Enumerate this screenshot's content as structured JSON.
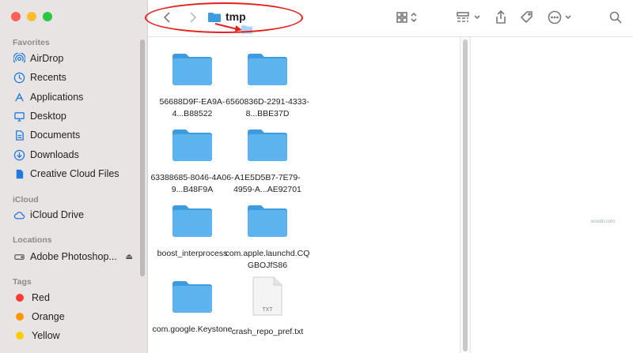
{
  "sidebar": {
    "favorites_header": "Favorites",
    "favorites": [
      {
        "label": "AirDrop",
        "icon": "airdrop-icon"
      },
      {
        "label": "Recents",
        "icon": "clock-icon"
      },
      {
        "label": "Applications",
        "icon": "applications-icon"
      },
      {
        "label": "Desktop",
        "icon": "desktop-icon"
      },
      {
        "label": "Documents",
        "icon": "document-icon"
      },
      {
        "label": "Downloads",
        "icon": "download-icon"
      },
      {
        "label": "Creative Cloud Files",
        "icon": "file-icon"
      }
    ],
    "icloud_header": "iCloud",
    "icloud": [
      {
        "label": "iCloud Drive",
        "icon": "cloud-icon"
      }
    ],
    "locations_header": "Locations",
    "locations": [
      {
        "label": "Adobe Photoshop...",
        "icon": "drive-icon",
        "eject": "⏏"
      }
    ],
    "tags_header": "Tags",
    "tags": [
      {
        "label": "Red",
        "color": "#fe3b30"
      },
      {
        "label": "Orange",
        "color": "#ff9500"
      },
      {
        "label": "Yellow",
        "color": "#ffcc00"
      }
    ]
  },
  "toolbar": {
    "title": "tmp",
    "back": "‹",
    "forward": "›"
  },
  "files": [
    {
      "label": "56688D9F-EA9A-4...B88522",
      "type": "folder"
    },
    {
      "label": "6560836D-2291-4333-8...BBE37D",
      "type": "folder"
    },
    {
      "label": "63388685-8046-4A06-9...B48F9A",
      "type": "folder"
    },
    {
      "label": "A1E5D5B7-7E79-4959-A...AE92701",
      "type": "folder"
    },
    {
      "label": "boost_interprocess",
      "type": "folder"
    },
    {
      "label": "com.apple.launchd.CQGBOJfS86",
      "type": "folder"
    },
    {
      "label": "com.google.Keystone",
      "type": "folder"
    },
    {
      "label": "crash_repo_pref.txt",
      "type": "txt",
      "badge": "TXT"
    }
  ],
  "watermark": "wsxdn.com",
  "colors": {
    "folder": "#5db3ee",
    "folder_dark": "#3f9be0",
    "annotation": "#e2211c",
    "accent": "#1f7ae0"
  }
}
